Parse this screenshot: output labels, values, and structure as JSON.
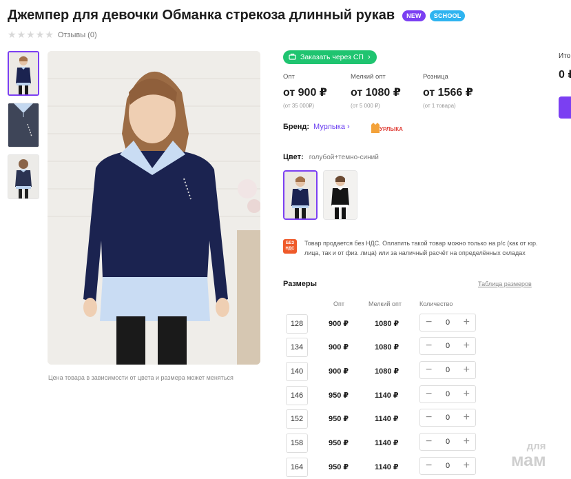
{
  "product": {
    "title": "Джемпер для девочки Обманка стрекоза длинный рукав",
    "badges": {
      "new": "NEW",
      "school": "SCHOOL"
    },
    "rating_stars": 0,
    "reviews": "Отзывы (0)"
  },
  "gallery": {
    "note": "Цена товара в зависимости от цвета и размера может меняться"
  },
  "purchase": {
    "sp_button": "Заказать через СП",
    "prices": [
      {
        "label": "Опт",
        "value": "от 900 ₽",
        "sub": "(от 35 000₽)"
      },
      {
        "label": "Мелкий опт",
        "value": "от 1080 ₽",
        "sub": "(от 5 000 ₽)"
      },
      {
        "label": "Розница",
        "value": "от 1566 ₽",
        "sub": "(от 1 товара)"
      }
    ],
    "brand_label": "Бренд:",
    "brand_name": "Мурлыка",
    "brand_logo_text": "МУРЛЫКА",
    "color_label": "Цвет:",
    "color_value": "голубой+темно-синий",
    "vat_icon": "БЕЗ НДС",
    "vat_text": "Товар продается без НДС. Оплатить такой товар можно только на р/с (как от юр. лица, так и от физ. лица) или за наличный расчёт на определённых складах",
    "sizes_title": "Размеры",
    "size_table_link": "Таблица размеров",
    "columns": {
      "opt": "Опт",
      "small_opt": "Мелкий опт",
      "qty": "Количество"
    },
    "sizes": [
      {
        "size": "128",
        "opt": "900 ₽",
        "small": "1080 ₽",
        "qty": "0"
      },
      {
        "size": "134",
        "opt": "900 ₽",
        "small": "1080 ₽",
        "qty": "0"
      },
      {
        "size": "140",
        "opt": "900 ₽",
        "small": "1080 ₽",
        "qty": "0"
      },
      {
        "size": "146",
        "opt": "950 ₽",
        "small": "1140 ₽",
        "qty": "0"
      },
      {
        "size": "152",
        "opt": "950 ₽",
        "small": "1140 ₽",
        "qty": "0"
      },
      {
        "size": "158",
        "opt": "950 ₽",
        "small": "1140 ₽",
        "qty": "0"
      },
      {
        "size": "164",
        "opt": "950 ₽",
        "small": "1140 ₽",
        "qty": "0"
      }
    ]
  },
  "side": {
    "total_label": "Ито",
    "total_value": "0 ₽"
  },
  "watermark": {
    "line1": "для",
    "line2": "мам"
  },
  "colors": {
    "accent": "#7b3ff2",
    "green": "#1fc470",
    "school": "#2fb4f0",
    "navy": "#1b2350",
    "vat": "#ef5a2a"
  }
}
